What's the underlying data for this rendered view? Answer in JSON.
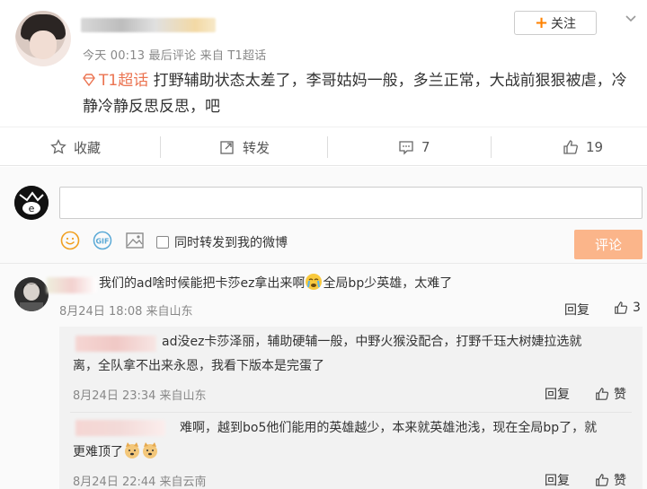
{
  "post": {
    "meta": "今天 00:13  最后评论  来自 T1超话",
    "follow_label": "关注",
    "follow_plus": "+",
    "topic_tag": "T1超话",
    "content_text": " 打野辅助状态太差了，李哥姑妈一般，多兰正常，大战前狠狠被虐，冷静冷静反思反思，吧"
  },
  "actions": {
    "favorite_label": "收藏",
    "repost_label": "转发",
    "comment_count": "7",
    "like_count": "19"
  },
  "composer": {
    "input_value": "",
    "repost_checkbox_label": "同时转发到我的微博",
    "submit_label": "评论"
  },
  "comments": [
    {
      "text_before": "我们的ad啥时候能把卡莎ez拿出来啊",
      "text_after": "全局bp少英雄，太难了",
      "meta": "8月24日 18:08 来自山东",
      "reply_label": "回复",
      "like_count": "3",
      "replies": [
        {
          "text_line1": "ad没ez卡莎泽丽，辅助硬辅一般，中野火猴没配合，打野千珏大树婕拉选就",
          "text_line2": "离，全队拿不出来永恩，我看下版本是完蛋了",
          "meta": "8月24日 23:34 来自山东",
          "reply_label": "回复",
          "like_label": "赞"
        },
        {
          "text_line1": "难啊，越到bo5他们能用的英雄越少，本来就英雄池浅，现在全局bp了，就",
          "text_line2": "更难顶了",
          "meta": "8月24日 22:44 来自云南",
          "reply_label": "回复",
          "like_label": "赞"
        }
      ]
    }
  ],
  "colors": {
    "accent": "#ff8200",
    "tag": "#eb7350",
    "submit_disabled": "#fbb58a"
  },
  "icons": {
    "favorite": "star-icon",
    "repost": "repost-icon",
    "comment": "comment-icon",
    "like": "thumbs-up-icon",
    "emoji": "smiley-icon",
    "gif": "gif-icon",
    "image": "image-icon",
    "tag": "diamond-tag-icon",
    "more": "chevron-down-icon"
  }
}
